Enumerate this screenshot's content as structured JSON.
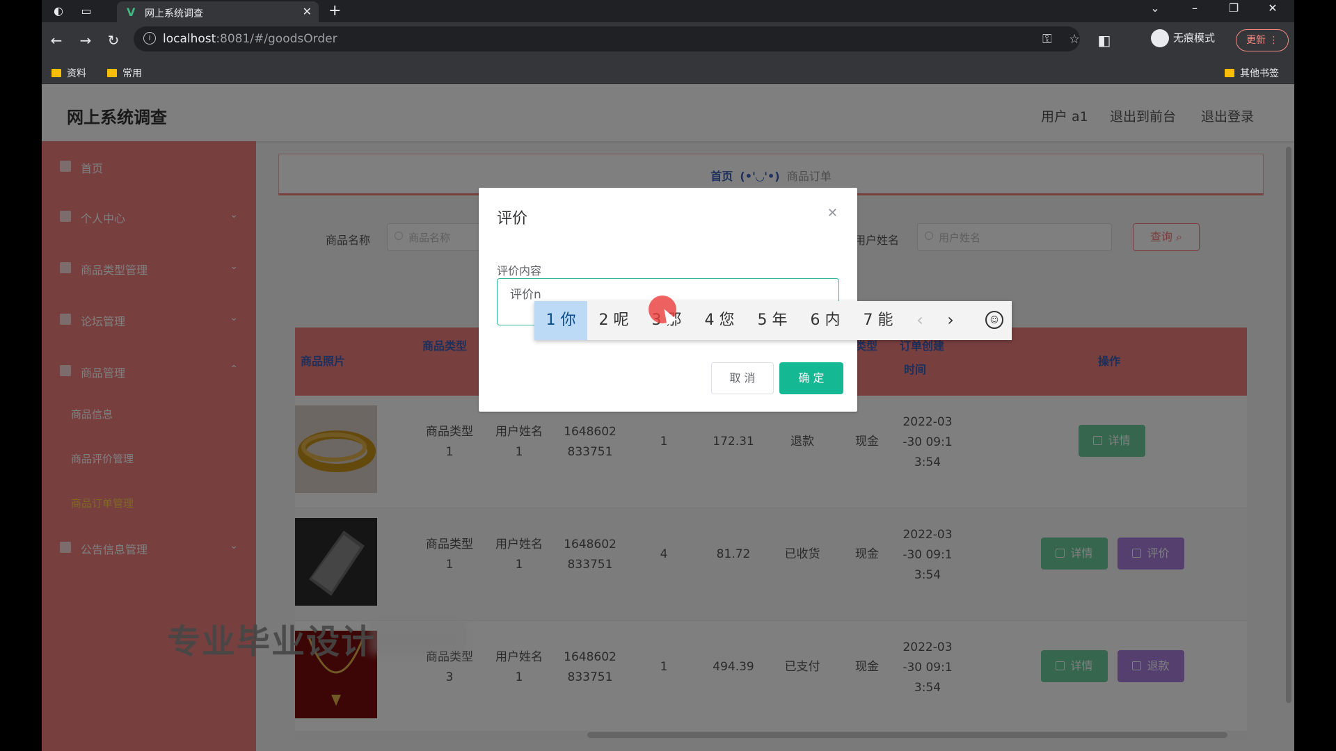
{
  "browser": {
    "tab_title": "网上系统调查",
    "url_host": "localhost",
    "url_rest": ":8081/#/goodsOrder",
    "incognito_label": "无痕模式",
    "update_label": "更新",
    "bookmarks": [
      "资料",
      "常用"
    ],
    "other_bookmarks": "其他书签"
  },
  "header": {
    "title": "网上系统调查",
    "user": "用户 a1",
    "back_to_front": "退出到前台",
    "logout": "退出登录"
  },
  "sidebar": {
    "items": [
      {
        "label": "首页"
      },
      {
        "label": "个人中心"
      },
      {
        "label": "商品类型管理"
      },
      {
        "label": "论坛管理"
      },
      {
        "label": "商品管理"
      }
    ],
    "subitems": [
      "商品信息",
      "商品评价管理",
      "商品订单管理"
    ],
    "last_item": "公告信息管理"
  },
  "breadcrumb": {
    "home": "首页",
    "face": "(•'◡'•)",
    "current": "商品订单"
  },
  "filters": {
    "goods_name_label": "商品名称",
    "goods_name_placeholder": "商品名称",
    "user_name_label": "用户姓名",
    "user_name_placeholder": "用户姓名",
    "search_label": "查询"
  },
  "table": {
    "headers": {
      "image": "商品照片",
      "type": "商品类型",
      "pay_type": "支付类型",
      "created_line1": "订单创建",
      "created_line2": "时间",
      "actions": "操作"
    },
    "rows": [
      {
        "type_l1": "商品类型",
        "type_l2": "1",
        "user_l1": "用户姓名",
        "user_l2": "1",
        "order_l1": "1648602",
        "order_l2": "833751",
        "qty": "1",
        "price": "172.31",
        "status": "退款",
        "pay": "现金",
        "time_l1": "2022-03",
        "time_l2": "-30 09:1",
        "time_l3": "3:54",
        "btn1": "详情",
        "btn2": ""
      },
      {
        "type_l1": "商品类型",
        "type_l2": "1",
        "user_l1": "用户姓名",
        "user_l2": "1",
        "order_l1": "1648602",
        "order_l2": "833751",
        "qty": "4",
        "price": "81.72",
        "status": "已收货",
        "pay": "现金",
        "time_l1": "2022-03",
        "time_l2": "-30 09:1",
        "time_l3": "3:54",
        "btn1": "详情",
        "btn2": "评价"
      },
      {
        "type_l1": "商品类型",
        "type_l2": "3",
        "user_l1": "用户姓名",
        "user_l2": "1",
        "order_l1": "1648602",
        "order_l2": "833751",
        "qty": "1",
        "price": "494.39",
        "status": "已支付",
        "pay": "现金",
        "time_l1": "2022-03",
        "time_l2": "-30 09:1",
        "time_l3": "3:54",
        "btn1": "详情",
        "btn2": "退款"
      }
    ]
  },
  "dialog": {
    "title": "评价",
    "field_label": "评价内容",
    "textarea_value": "评价n",
    "cancel": "取 消",
    "ok": "确 定"
  },
  "ime": {
    "candidates": [
      "1 你",
      "2 呢",
      "3 那",
      "4 您",
      "5 年",
      "6 内",
      "7 能"
    ],
    "prev": "‹",
    "next": "›"
  },
  "watermark": "专业毕业设计",
  "colors": {
    "sidebar": "#f07f7f",
    "primary": "#14b892",
    "detail_btn": "#6ccf9d",
    "secondary_btn": "#a97fdf"
  }
}
